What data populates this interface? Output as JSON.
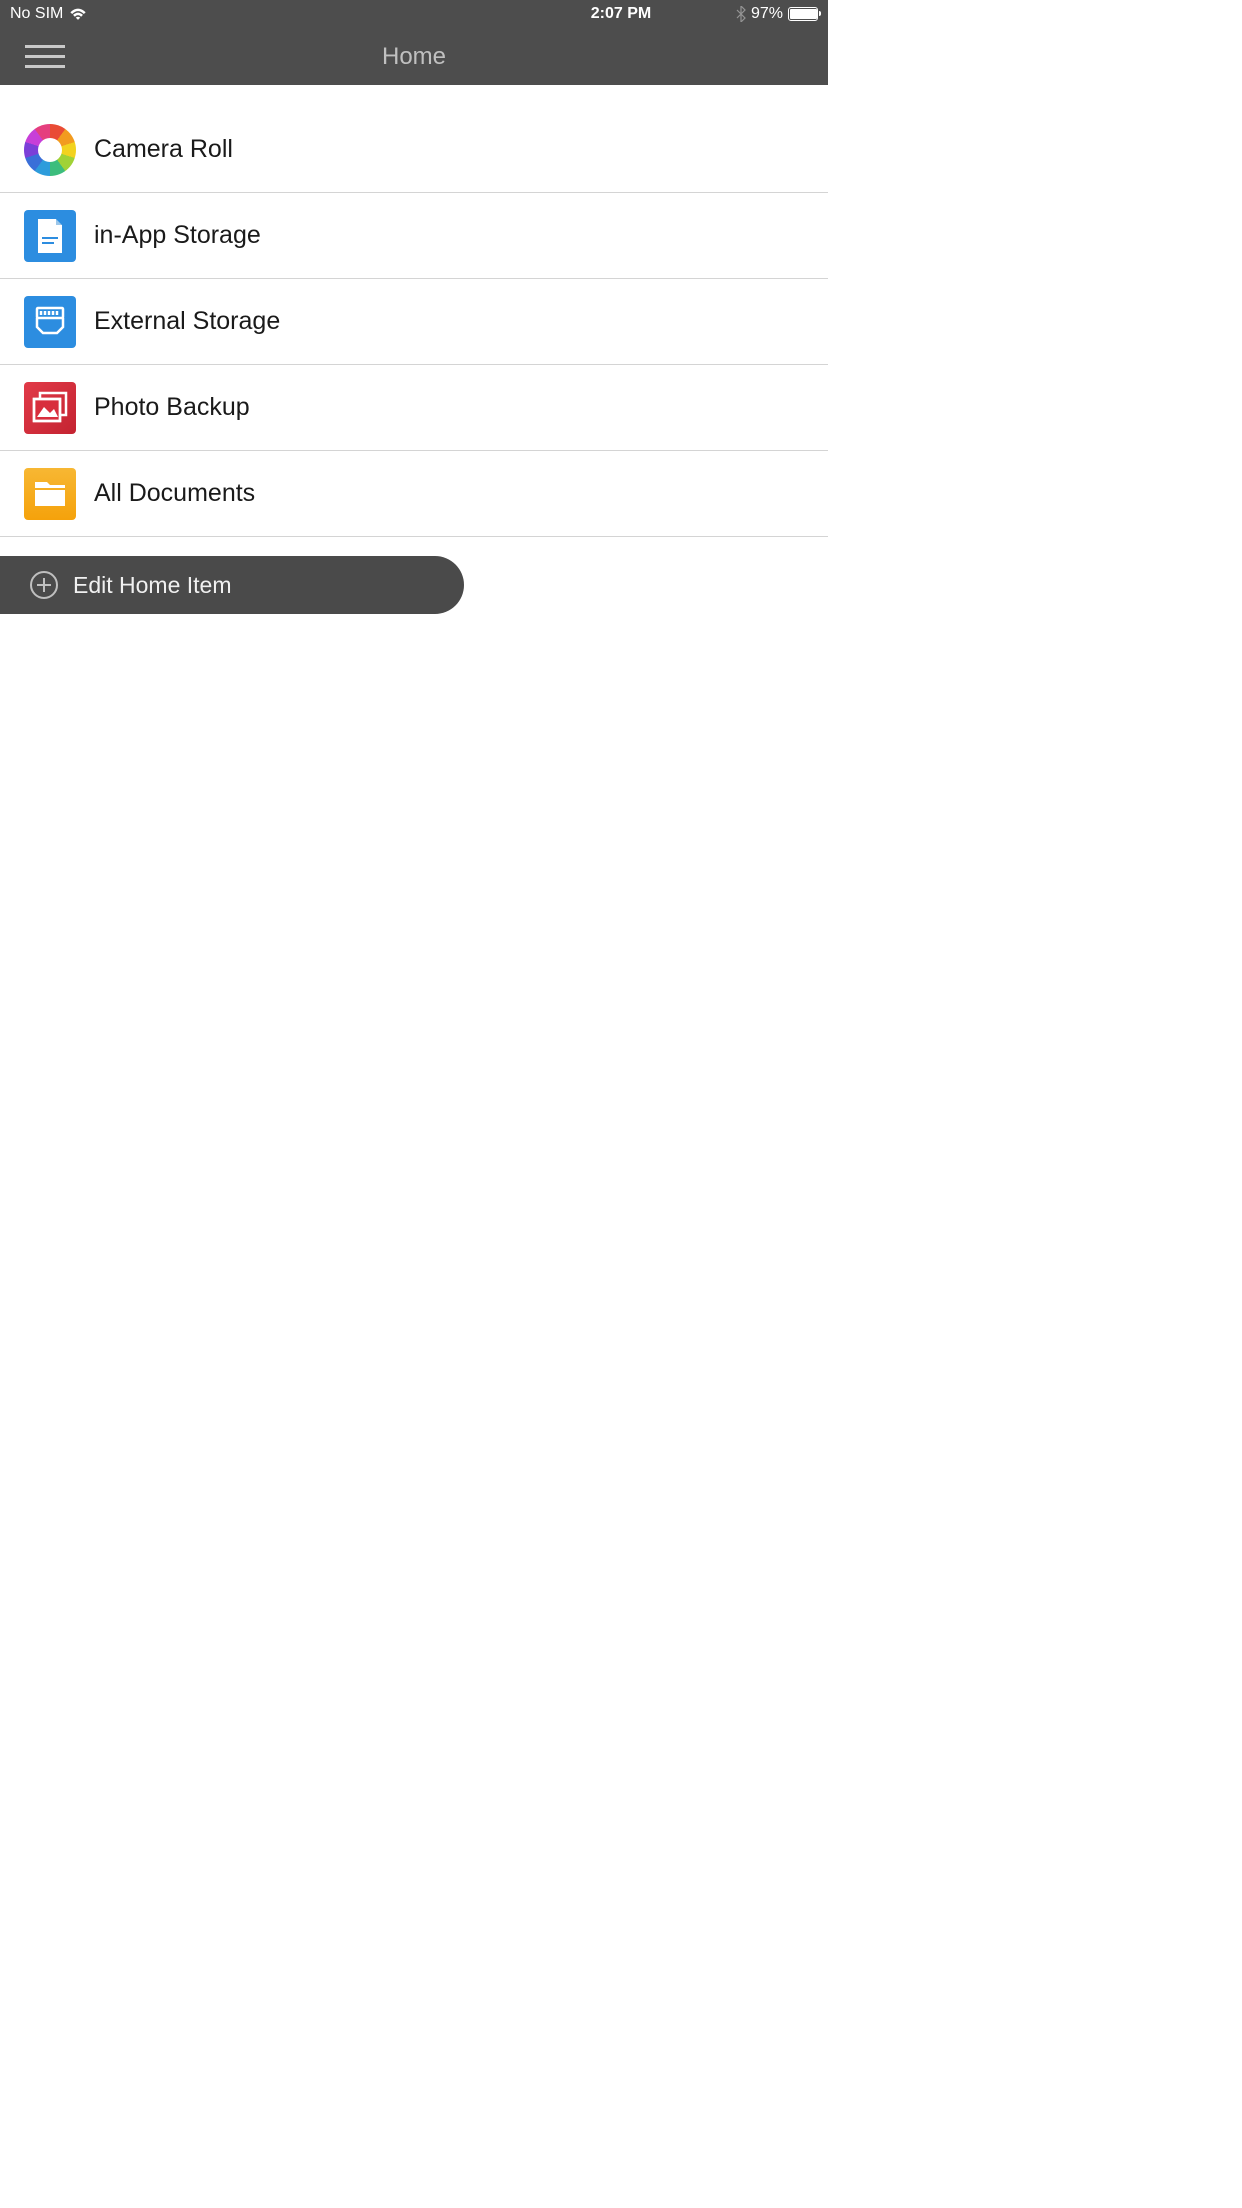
{
  "status": {
    "carrier": "No SIM",
    "time": "2:07 PM",
    "battery_pct": "97%"
  },
  "nav": {
    "title": "Home"
  },
  "items": [
    {
      "label": "Camera Roll",
      "icon": "color-wheel-icon"
    },
    {
      "label": "in-App Storage",
      "icon": "document-icon"
    },
    {
      "label": "External Storage",
      "icon": "sd-card-icon"
    },
    {
      "label": "Photo Backup",
      "icon": "photo-backup-icon"
    },
    {
      "label": "All Documents",
      "icon": "folder-icon"
    }
  ],
  "edit_button": {
    "label": "Edit Home Item"
  }
}
